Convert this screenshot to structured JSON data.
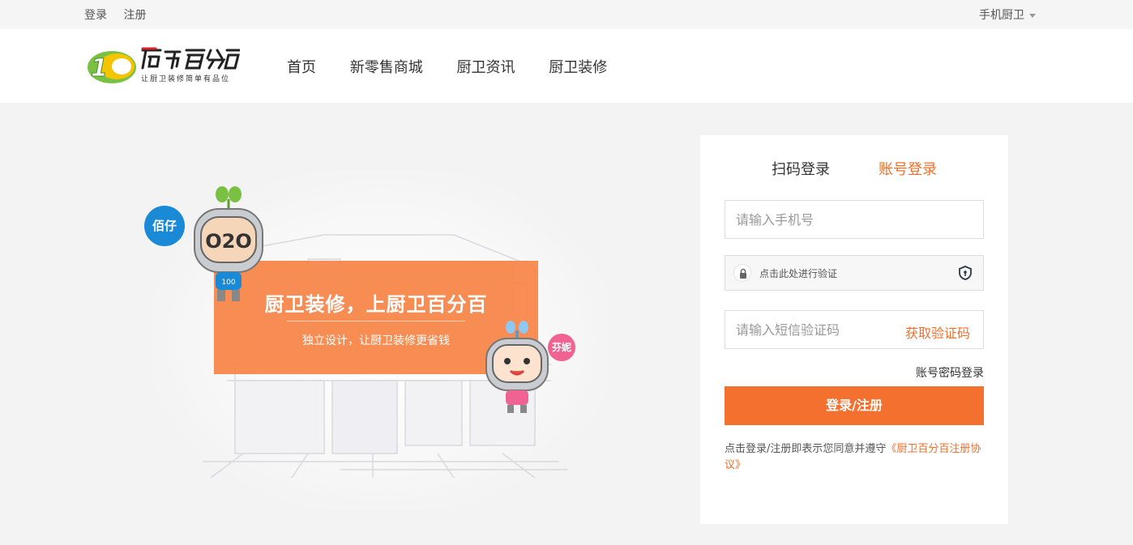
{
  "topbar": {
    "login": "登录",
    "register": "注册",
    "mobile": "手机厨卫"
  },
  "header": {
    "logo_subtitle": "让厨卫装修简单有品位",
    "nav": [
      "首页",
      "新零售商城",
      "厨卫资讯",
      "厨卫装修"
    ]
  },
  "hero": {
    "title": "厨卫装修，上厨卫百分百",
    "subtitle": "独立设计，让厨卫装修更省钱",
    "mascot_left_badge": "佰仔",
    "mascot_right_badge": "芬妮",
    "mascot_left_face": "O2O",
    "mascot_left_shirt": "100"
  },
  "login": {
    "tab_qr": "扫码登录",
    "tab_account": "账号登录",
    "phone_placeholder": "请输入手机号",
    "verify_text": "点击此处进行验证",
    "sms_placeholder": "请输入短信验证码",
    "sms_button": "获取验证码",
    "password_login": "账号密码登录",
    "submit": "登录/注册",
    "agreement_prefix": "点击登录/注册即表示您同意并遵守",
    "agreement_link": "《厨卫百分百注册协议》"
  },
  "colors": {
    "accent": "#f4702f",
    "banner": "#f8874a",
    "blue_badge": "#1a8ad6",
    "pink_badge": "#f06292"
  }
}
